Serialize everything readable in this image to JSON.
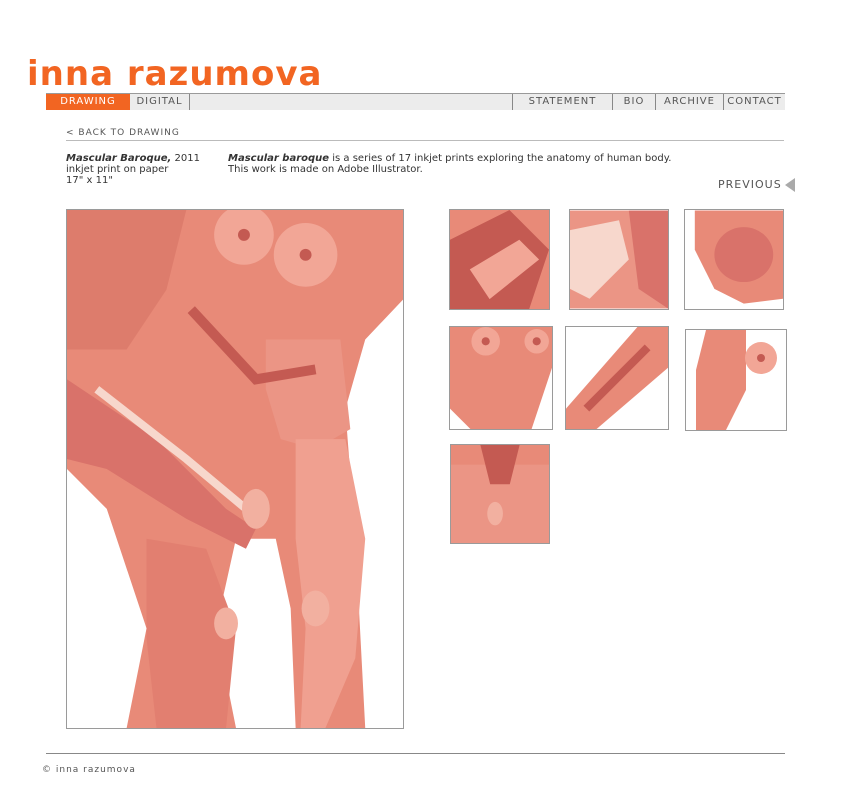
{
  "site": {
    "logo_text": "inna razumova"
  },
  "nav": {
    "left": [
      {
        "label": "DRAWING"
      },
      {
        "label": "DIGITAL"
      }
    ],
    "right": [
      {
        "label": "STATEMENT"
      },
      {
        "label": "BIO"
      },
      {
        "label": "ARCHIVE"
      },
      {
        "label": "CONTACT"
      }
    ]
  },
  "page": {
    "back_link": "< BACK TO DRAWING",
    "work_title": "Mascular Baroque,",
    "work_year": "2011",
    "medium": "inkjet print on paper",
    "size": "17\" x 11\"",
    "desc_title": "Mascular baroque",
    "desc_line1": "is a series of 17 inkjet prints exploring the anatomy of human body.",
    "desc_line2": "This work is made on Adobe Illustrator.",
    "previous_label": "PREVIOUS"
  },
  "colors": {
    "accent": "#f26522",
    "muscle": "#e88a78",
    "muscle_dark": "#c45a52",
    "muscle_light": "#f7c9bc"
  },
  "footer": {
    "copyright": "© inna razumova"
  }
}
